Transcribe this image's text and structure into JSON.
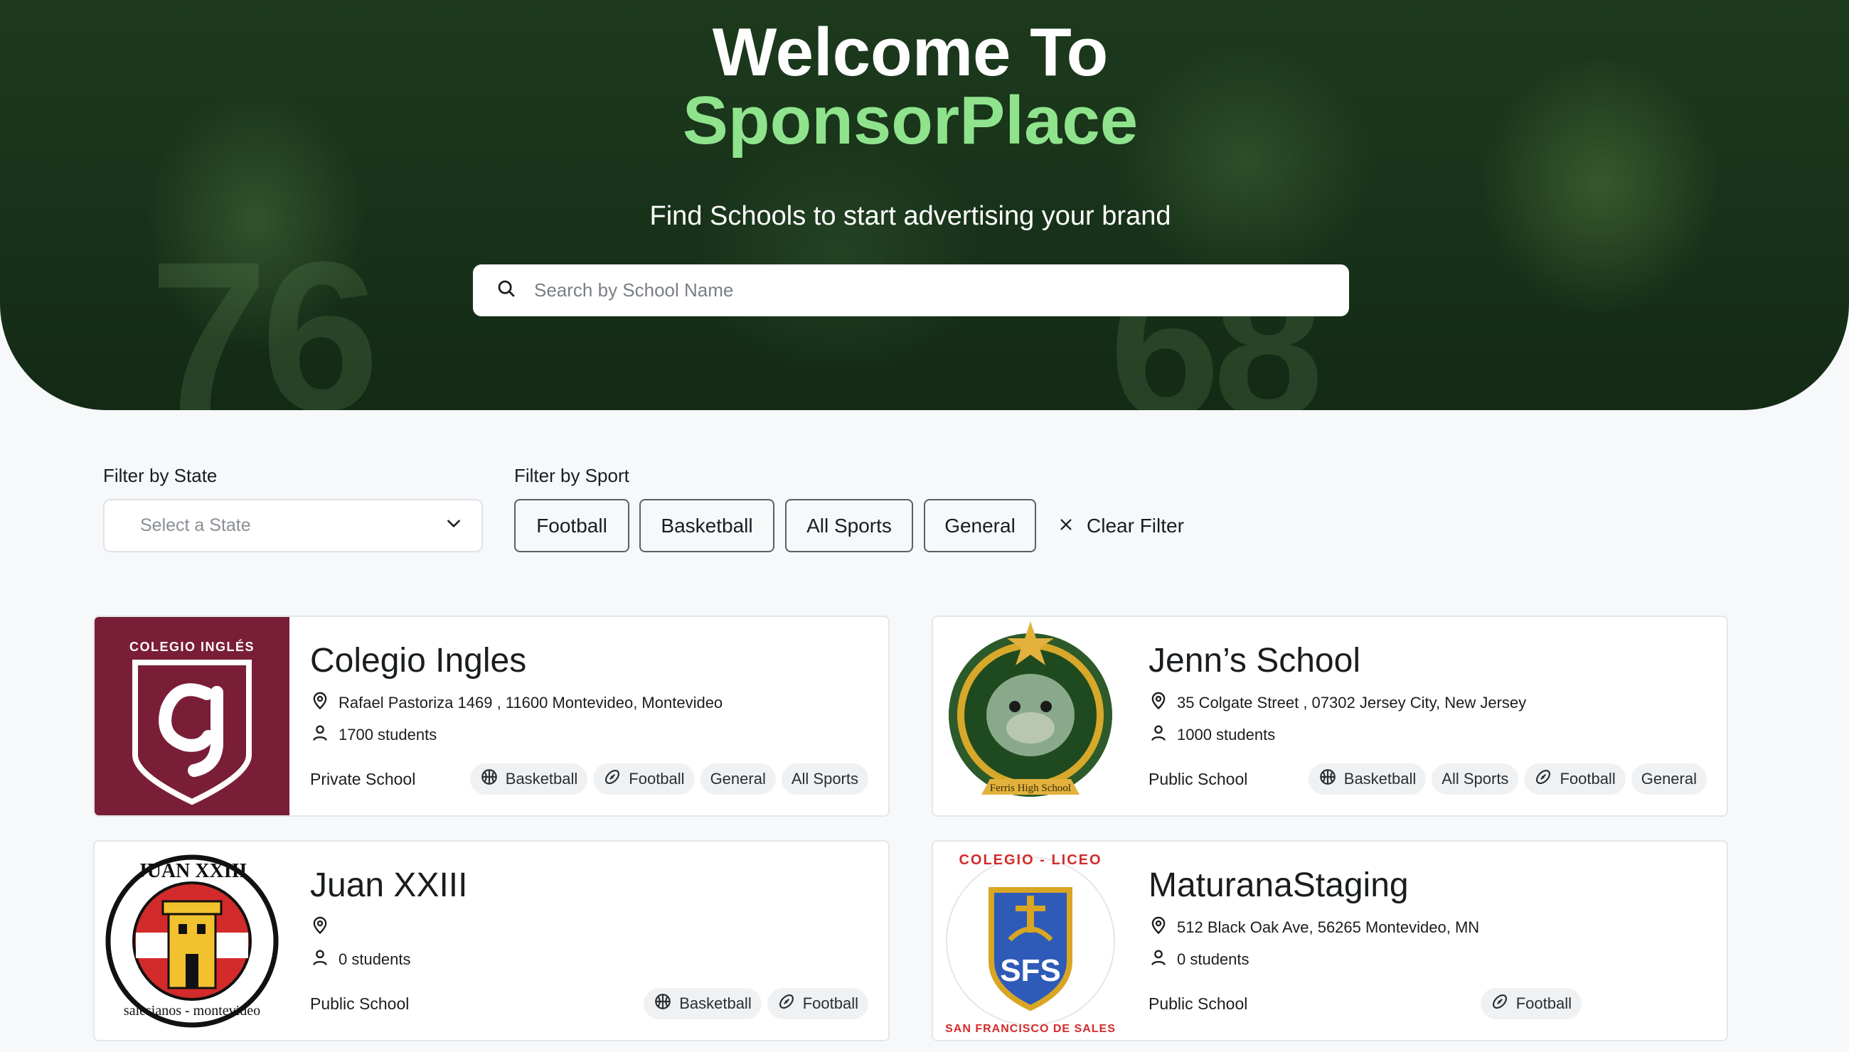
{
  "hero": {
    "title_line1": "Welcome To",
    "title_line2": "SponsorPlace",
    "subtitle": "Find Schools to start advertising your brand",
    "search_placeholder": "Search by School Name",
    "brand_color": "#8fe38c"
  },
  "filters": {
    "state_label": "Filter by State",
    "state_placeholder": "Select a State",
    "sport_label": "Filter by Sport",
    "sports": [
      "Football",
      "Basketball",
      "All Sports",
      "General"
    ],
    "clear_label": "Clear Filter"
  },
  "schools": [
    {
      "name": "Colegio Ingles",
      "address": "Rafael Pastoriza 1469 , 11600 Montevideo, Montevideo",
      "students": "1700 students",
      "type": "Private School",
      "logo_text": "COLEGIO INGLÉS",
      "tags": [
        {
          "label": "Basketball",
          "icon": "basketball-icon"
        },
        {
          "label": "Football",
          "icon": "football-icon"
        },
        {
          "label": "General",
          "icon": ""
        },
        {
          "label": "All Sports",
          "icon": ""
        }
      ]
    },
    {
      "name": "Jenn’s School",
      "address": "35 Colgate Street , 07302 Jersey City, New Jersey",
      "students": "1000 students",
      "type": "Public School",
      "logo_text": "Ferris High School",
      "tags": [
        {
          "label": "Basketball",
          "icon": "basketball-icon"
        },
        {
          "label": "All Sports",
          "icon": ""
        },
        {
          "label": "Football",
          "icon": "football-icon"
        },
        {
          "label": "General",
          "icon": ""
        }
      ]
    },
    {
      "name": "Juan XXIII",
      "address": "",
      "students": "0 students",
      "type": "Public School",
      "logo_text": "JUAN XXIII",
      "logo_text2": "salesianos - montevideo",
      "tags": [
        {
          "label": "Basketball",
          "icon": "basketball-icon"
        },
        {
          "label": "Football",
          "icon": "football-icon"
        }
      ]
    },
    {
      "name": "MaturanaStaging",
      "address": "512 Black Oak Ave, 56265 Montevideo, MN",
      "students": "0 students",
      "type": "Public School",
      "logo_text": "COLEGIO - LICEO",
      "logo_text2": "SAN FRANCISCO DE SALES",
      "tags": [
        {
          "label": "Football",
          "icon": "football-icon"
        }
      ]
    }
  ]
}
